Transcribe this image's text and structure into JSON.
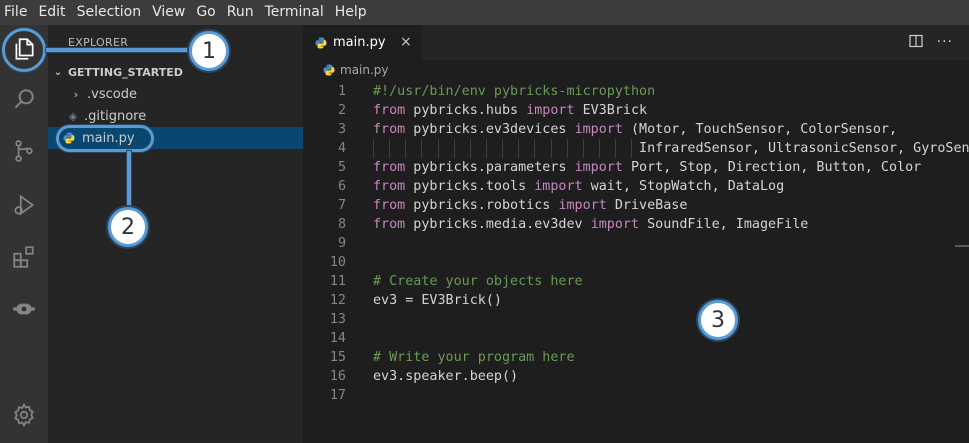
{
  "menu": [
    "File",
    "Edit",
    "Selection",
    "View",
    "Go",
    "Run",
    "Terminal",
    "Help"
  ],
  "activity_bar": [
    {
      "name": "explorer-icon"
    },
    {
      "name": "search-icon"
    },
    {
      "name": "source-control-icon"
    },
    {
      "name": "run-debug-icon"
    },
    {
      "name": "extensions-icon"
    },
    {
      "name": "ev3-device-icon"
    },
    {
      "name": "settings-gear-icon"
    }
  ],
  "sidebar": {
    "title": "EXPLORER",
    "section": "GETTING_STARTED",
    "items": [
      {
        "label": ".vscode",
        "icon": "chevron-right-icon"
      },
      {
        "label": ".gitignore",
        "icon": "gitignore-icon"
      },
      {
        "label": "main.py",
        "icon": "python-icon",
        "selected": true
      }
    ]
  },
  "editor": {
    "tab_label": "main.py",
    "close_glyph": "×",
    "breadcrumb": "main.py",
    "lines": [
      {
        "n": "1",
        "parts": [
          {
            "t": "#!/usr/bin/env pybricks-micropython",
            "c": "cm"
          }
        ]
      },
      {
        "n": "2",
        "parts": [
          {
            "t": "from",
            "c": "kw"
          },
          {
            "t": " pybricks.hubs ",
            "c": ""
          },
          {
            "t": "import",
            "c": "kw"
          },
          {
            "t": " EV3Brick",
            "c": ""
          }
        ]
      },
      {
        "n": "3",
        "parts": [
          {
            "t": "from",
            "c": "kw"
          },
          {
            "t": " pybricks.ev3devices ",
            "c": ""
          },
          {
            "t": "import",
            "c": "kw"
          },
          {
            "t": " (Motor, TouchSensor, ColorSensor,",
            "c": ""
          }
        ]
      },
      {
        "n": "4",
        "parts": [
          {
            "t": "                                 InfraredSensor, UltrasonicSensor, GyroSensor)",
            "c": ""
          }
        ],
        "guides": true
      },
      {
        "n": "5",
        "parts": [
          {
            "t": "from",
            "c": "kw"
          },
          {
            "t": " pybricks.parameters ",
            "c": ""
          },
          {
            "t": "import",
            "c": "kw"
          },
          {
            "t": " Port, Stop, Direction, Button, Color",
            "c": ""
          }
        ]
      },
      {
        "n": "6",
        "parts": [
          {
            "t": "from",
            "c": "kw"
          },
          {
            "t": " pybricks.tools ",
            "c": ""
          },
          {
            "t": "import",
            "c": "kw"
          },
          {
            "t": " wait, StopWatch, DataLog",
            "c": ""
          }
        ]
      },
      {
        "n": "7",
        "parts": [
          {
            "t": "from",
            "c": "kw"
          },
          {
            "t": " pybricks.robotics ",
            "c": ""
          },
          {
            "t": "import",
            "c": "kw"
          },
          {
            "t": " DriveBase",
            "c": ""
          }
        ]
      },
      {
        "n": "8",
        "parts": [
          {
            "t": "from",
            "c": "kw"
          },
          {
            "t": " pybricks.media.ev3dev ",
            "c": ""
          },
          {
            "t": "import",
            "c": "kw"
          },
          {
            "t": " SoundFile, ImageFile",
            "c": ""
          }
        ]
      },
      {
        "n": "9",
        "parts": []
      },
      {
        "n": "10",
        "parts": []
      },
      {
        "n": "11",
        "parts": [
          {
            "t": "# Create your objects here",
            "c": "cm"
          }
        ]
      },
      {
        "n": "12",
        "parts": [
          {
            "t": "ev3 = EV3Brick()",
            "c": ""
          }
        ]
      },
      {
        "n": "13",
        "parts": []
      },
      {
        "n": "14",
        "parts": []
      },
      {
        "n": "15",
        "parts": [
          {
            "t": "# Write your program here",
            "c": "cm"
          }
        ]
      },
      {
        "n": "16",
        "parts": [
          {
            "t": "ev3.speaker.beep()",
            "c": ""
          }
        ]
      },
      {
        "n": "17",
        "parts": []
      }
    ]
  },
  "callouts": [
    "1",
    "2",
    "3"
  ],
  "colors": {
    "accent": "#5b9bd5",
    "keyword": "#c586c0",
    "comment": "#6a9955",
    "selection": "#094771"
  }
}
